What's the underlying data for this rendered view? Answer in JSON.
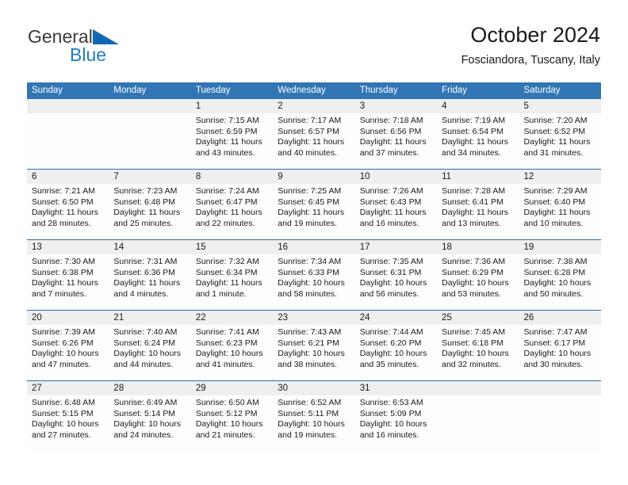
{
  "brand": {
    "name_dark": "General",
    "name_blue": "Blue",
    "triangle_color": "#1268b3"
  },
  "header": {
    "title": "October 2024",
    "subtitle": "Fosciandora, Tuscany, Italy",
    "header_bg": "#3275b5",
    "week_divider": "#2f6ea8",
    "daynum_band": "#efefef"
  },
  "weekday_headers": [
    "Sunday",
    "Monday",
    "Tuesday",
    "Wednesday",
    "Thursday",
    "Friday",
    "Saturday"
  ],
  "weeks": [
    [
      {
        "day": "",
        "lines": []
      },
      {
        "day": "",
        "lines": []
      },
      {
        "day": "1",
        "lines": [
          "Sunrise: 7:15 AM",
          "Sunset: 6:59 PM",
          "Daylight: 11 hours",
          "and 43 minutes."
        ]
      },
      {
        "day": "2",
        "lines": [
          "Sunrise: 7:17 AM",
          "Sunset: 6:57 PM",
          "Daylight: 11 hours",
          "and 40 minutes."
        ]
      },
      {
        "day": "3",
        "lines": [
          "Sunrise: 7:18 AM",
          "Sunset: 6:56 PM",
          "Daylight: 11 hours",
          "and 37 minutes."
        ]
      },
      {
        "day": "4",
        "lines": [
          "Sunrise: 7:19 AM",
          "Sunset: 6:54 PM",
          "Daylight: 11 hours",
          "and 34 minutes."
        ]
      },
      {
        "day": "5",
        "lines": [
          "Sunrise: 7:20 AM",
          "Sunset: 6:52 PM",
          "Daylight: 11 hours",
          "and 31 minutes."
        ]
      }
    ],
    [
      {
        "day": "6",
        "lines": [
          "Sunrise: 7:21 AM",
          "Sunset: 6:50 PM",
          "Daylight: 11 hours",
          "and 28 minutes."
        ]
      },
      {
        "day": "7",
        "lines": [
          "Sunrise: 7:23 AM",
          "Sunset: 6:48 PM",
          "Daylight: 11 hours",
          "and 25 minutes."
        ]
      },
      {
        "day": "8",
        "lines": [
          "Sunrise: 7:24 AM",
          "Sunset: 6:47 PM",
          "Daylight: 11 hours",
          "and 22 minutes."
        ]
      },
      {
        "day": "9",
        "lines": [
          "Sunrise: 7:25 AM",
          "Sunset: 6:45 PM",
          "Daylight: 11 hours",
          "and 19 minutes."
        ]
      },
      {
        "day": "10",
        "lines": [
          "Sunrise: 7:26 AM",
          "Sunset: 6:43 PM",
          "Daylight: 11 hours",
          "and 16 minutes."
        ]
      },
      {
        "day": "11",
        "lines": [
          "Sunrise: 7:28 AM",
          "Sunset: 6:41 PM",
          "Daylight: 11 hours",
          "and 13 minutes."
        ]
      },
      {
        "day": "12",
        "lines": [
          "Sunrise: 7:29 AM",
          "Sunset: 6:40 PM",
          "Daylight: 11 hours",
          "and 10 minutes."
        ]
      }
    ],
    [
      {
        "day": "13",
        "lines": [
          "Sunrise: 7:30 AM",
          "Sunset: 6:38 PM",
          "Daylight: 11 hours",
          "and 7 minutes."
        ]
      },
      {
        "day": "14",
        "lines": [
          "Sunrise: 7:31 AM",
          "Sunset: 6:36 PM",
          "Daylight: 11 hours",
          "and 4 minutes."
        ]
      },
      {
        "day": "15",
        "lines": [
          "Sunrise: 7:32 AM",
          "Sunset: 6:34 PM",
          "Daylight: 11 hours",
          "and 1 minute."
        ]
      },
      {
        "day": "16",
        "lines": [
          "Sunrise: 7:34 AM",
          "Sunset: 6:33 PM",
          "Daylight: 10 hours",
          "and 58 minutes."
        ]
      },
      {
        "day": "17",
        "lines": [
          "Sunrise: 7:35 AM",
          "Sunset: 6:31 PM",
          "Daylight: 10 hours",
          "and 56 minutes."
        ]
      },
      {
        "day": "18",
        "lines": [
          "Sunrise: 7:36 AM",
          "Sunset: 6:29 PM",
          "Daylight: 10 hours",
          "and 53 minutes."
        ]
      },
      {
        "day": "19",
        "lines": [
          "Sunrise: 7:38 AM",
          "Sunset: 6:28 PM",
          "Daylight: 10 hours",
          "and 50 minutes."
        ]
      }
    ],
    [
      {
        "day": "20",
        "lines": [
          "Sunrise: 7:39 AM",
          "Sunset: 6:26 PM",
          "Daylight: 10 hours",
          "and 47 minutes."
        ]
      },
      {
        "day": "21",
        "lines": [
          "Sunrise: 7:40 AM",
          "Sunset: 6:24 PM",
          "Daylight: 10 hours",
          "and 44 minutes."
        ]
      },
      {
        "day": "22",
        "lines": [
          "Sunrise: 7:41 AM",
          "Sunset: 6:23 PM",
          "Daylight: 10 hours",
          "and 41 minutes."
        ]
      },
      {
        "day": "23",
        "lines": [
          "Sunrise: 7:43 AM",
          "Sunset: 6:21 PM",
          "Daylight: 10 hours",
          "and 38 minutes."
        ]
      },
      {
        "day": "24",
        "lines": [
          "Sunrise: 7:44 AM",
          "Sunset: 6:20 PM",
          "Daylight: 10 hours",
          "and 35 minutes."
        ]
      },
      {
        "day": "25",
        "lines": [
          "Sunrise: 7:45 AM",
          "Sunset: 6:18 PM",
          "Daylight: 10 hours",
          "and 32 minutes."
        ]
      },
      {
        "day": "26",
        "lines": [
          "Sunrise: 7:47 AM",
          "Sunset: 6:17 PM",
          "Daylight: 10 hours",
          "and 30 minutes."
        ]
      }
    ],
    [
      {
        "day": "27",
        "lines": [
          "Sunrise: 6:48 AM",
          "Sunset: 5:15 PM",
          "Daylight: 10 hours",
          "and 27 minutes."
        ]
      },
      {
        "day": "28",
        "lines": [
          "Sunrise: 6:49 AM",
          "Sunset: 5:14 PM",
          "Daylight: 10 hours",
          "and 24 minutes."
        ]
      },
      {
        "day": "29",
        "lines": [
          "Sunrise: 6:50 AM",
          "Sunset: 5:12 PM",
          "Daylight: 10 hours",
          "and 21 minutes."
        ]
      },
      {
        "day": "30",
        "lines": [
          "Sunrise: 6:52 AM",
          "Sunset: 5:11 PM",
          "Daylight: 10 hours",
          "and 19 minutes."
        ]
      },
      {
        "day": "31",
        "lines": [
          "Sunrise: 6:53 AM",
          "Sunset: 5:09 PM",
          "Daylight: 10 hours",
          "and 16 minutes."
        ]
      },
      {
        "day": "",
        "lines": []
      },
      {
        "day": "",
        "lines": []
      }
    ]
  ]
}
